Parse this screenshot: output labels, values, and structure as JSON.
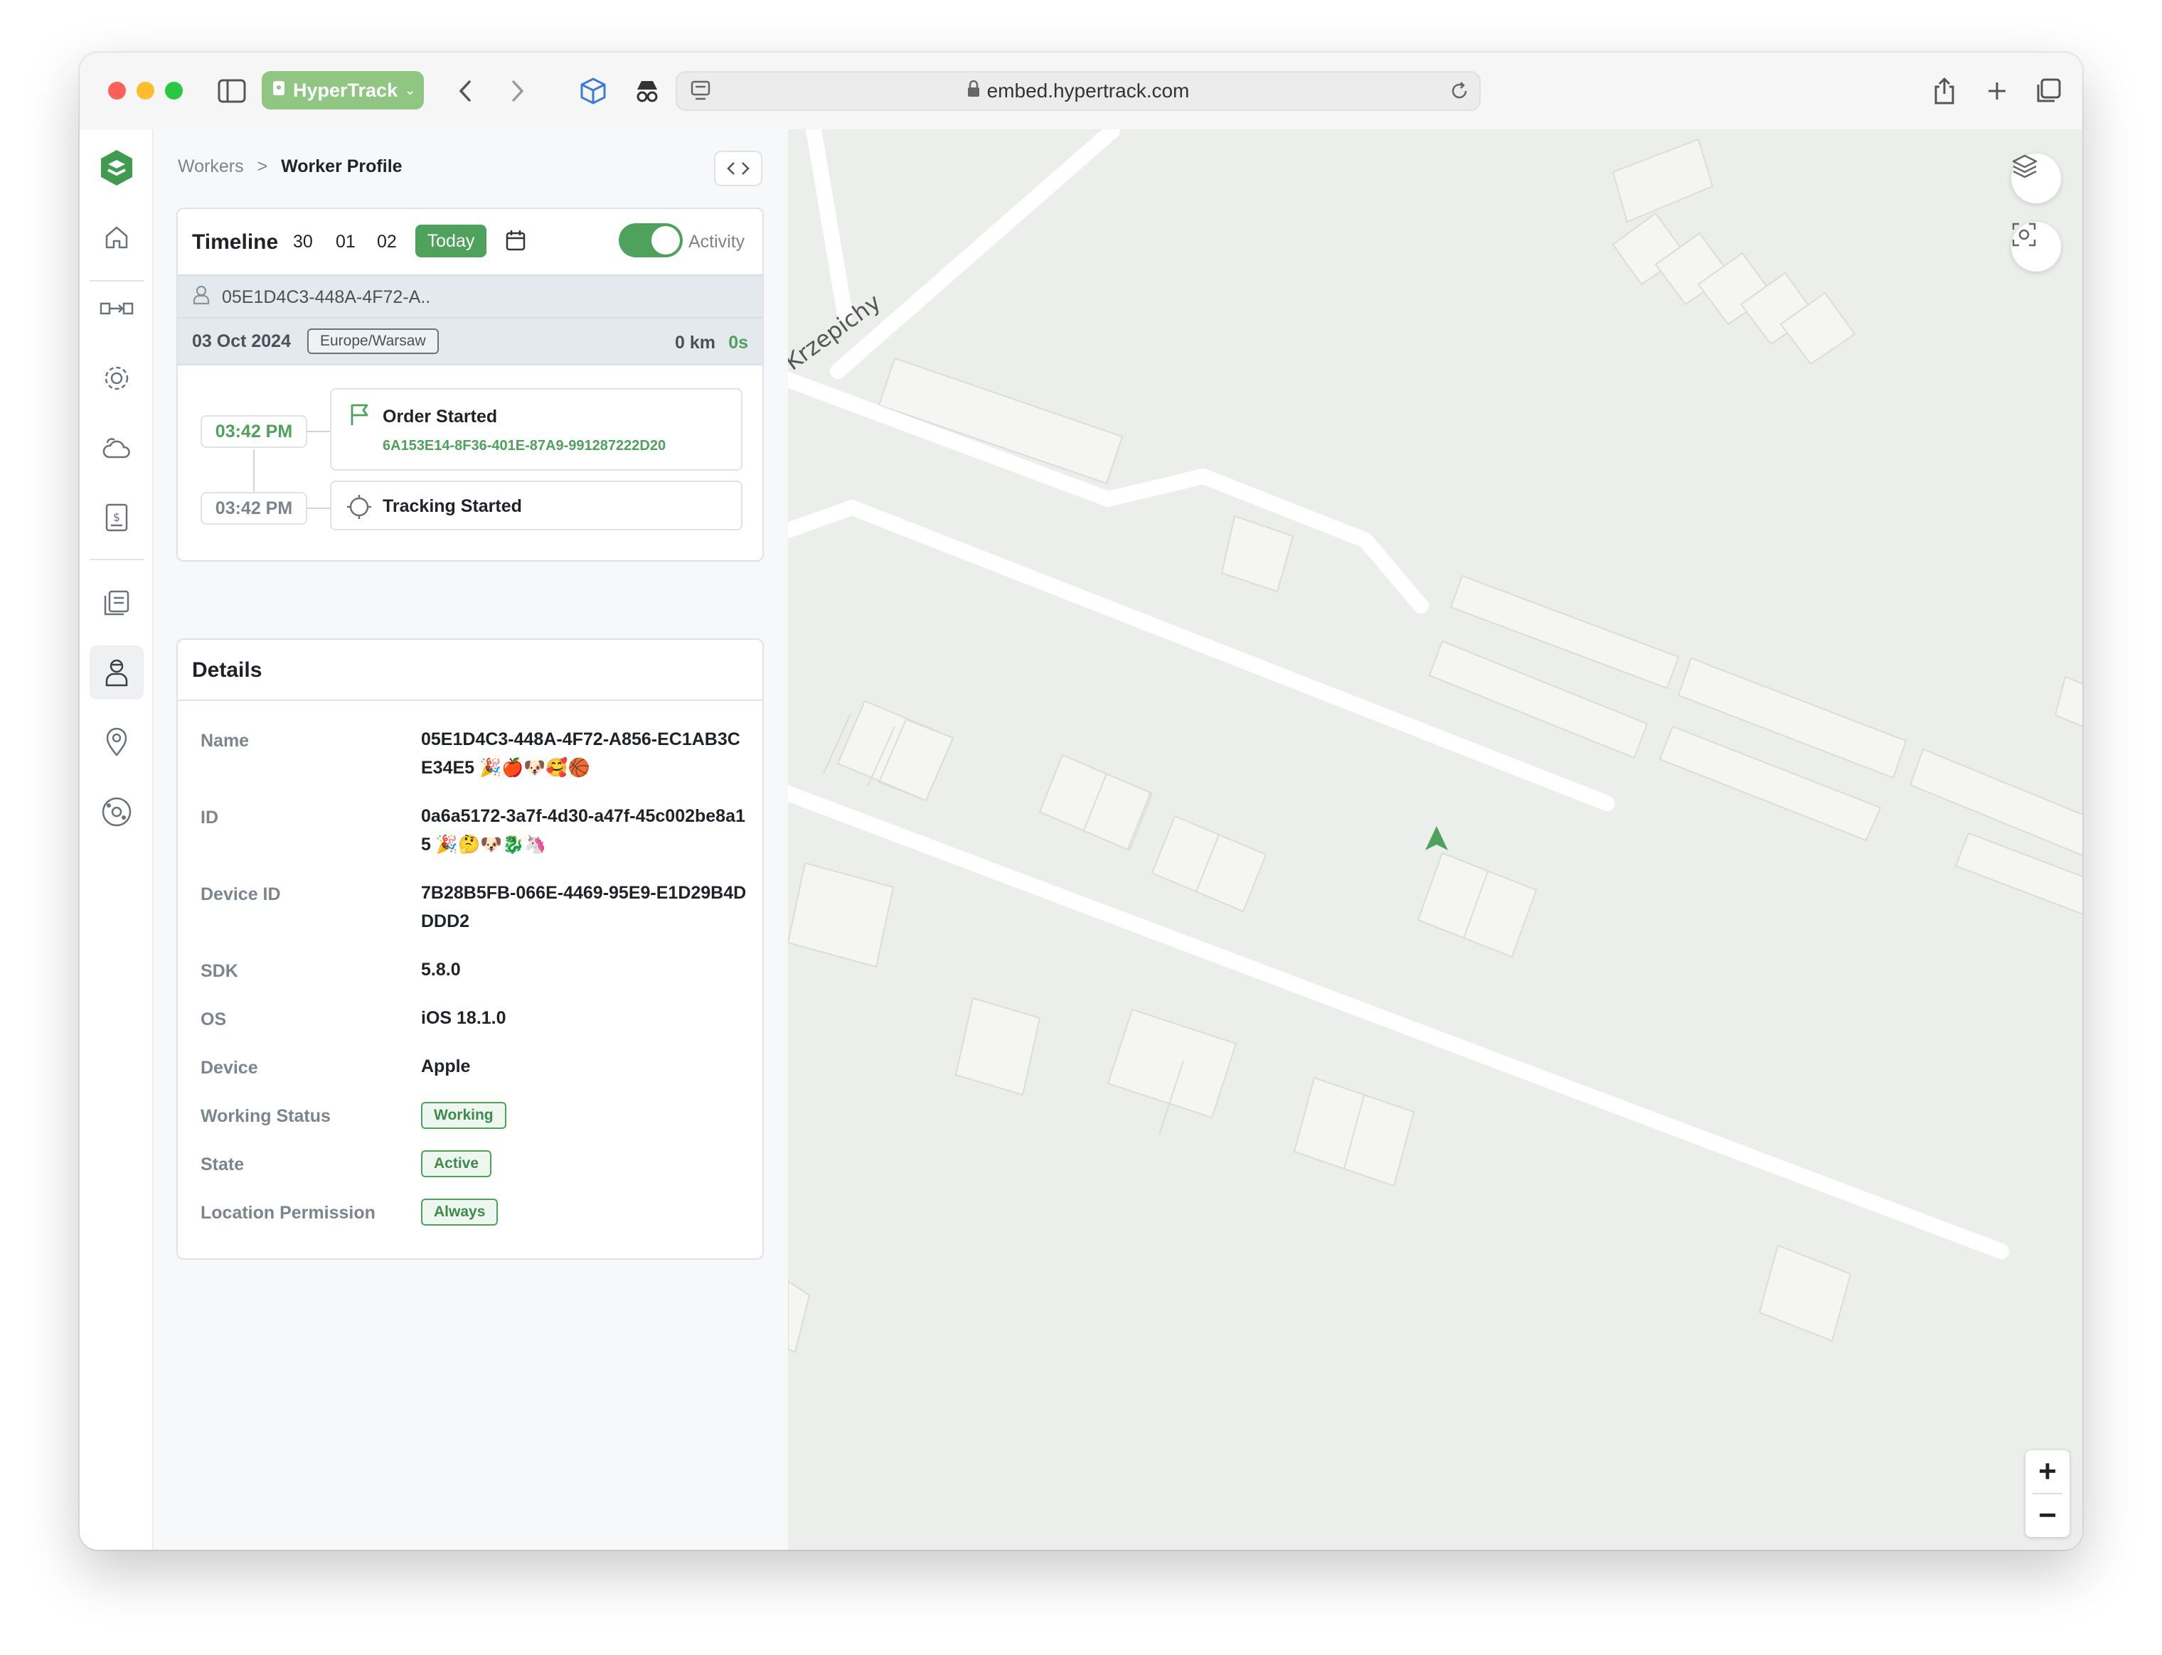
{
  "browser": {
    "profile_label": "HyperTrack",
    "url": "embed.hypertrack.com"
  },
  "breadcrumb": {
    "parent": "Workers",
    "separator": ">",
    "current": "Worker Profile"
  },
  "timeline": {
    "title": "Timeline",
    "days": [
      "30",
      "01",
      "02"
    ],
    "today_label": "Today",
    "activity_label": "Activity",
    "activity_on": true,
    "worker_short_id": "05E1D4C3-448A-4F72-A..",
    "date": "03 Oct 2024",
    "timezone": "Europe/Warsaw",
    "distance": "0 km",
    "duration": "0s",
    "events": [
      {
        "time": "03:42 PM",
        "title": "Order Started",
        "subtitle": "6A153E14-8F36-401E-87A9-991287222D20",
        "icon": "flag-icon"
      },
      {
        "time": "03:42 PM",
        "title": "Tracking Started",
        "subtitle": "",
        "icon": "crosshair-icon"
      }
    ]
  },
  "details": {
    "title": "Details",
    "rows": [
      {
        "label": "Name",
        "value": "05E1D4C3-448A-4F72-A856-EC1AB3CE34E5 🎉🍎🐶🥰🏀"
      },
      {
        "label": "ID",
        "value": "0a6a5172-3a7f-4d30-a47f-45c002be8a15 🎉🤔🐶🐉🦄"
      },
      {
        "label": "Device ID",
        "value": "7B28B5FB-066E-4469-95E9-E1D29B4DDDD2"
      },
      {
        "label": "SDK",
        "value": "5.8.0"
      },
      {
        "label": "OS",
        "value": "iOS 18.1.0"
      },
      {
        "label": "Device",
        "value": "Apple"
      }
    ],
    "badges": [
      {
        "label": "Working Status",
        "value": "Working"
      },
      {
        "label": "State",
        "value": "Active"
      },
      {
        "label": "Location Permission",
        "value": "Always"
      }
    ]
  },
  "map": {
    "street_label": "Krzepichy",
    "zoom_in": "+",
    "zoom_out": "−",
    "accent": "#4ea25b"
  },
  "colors": {
    "accent": "#4ea25b",
    "map_background": "#eceeeb"
  }
}
